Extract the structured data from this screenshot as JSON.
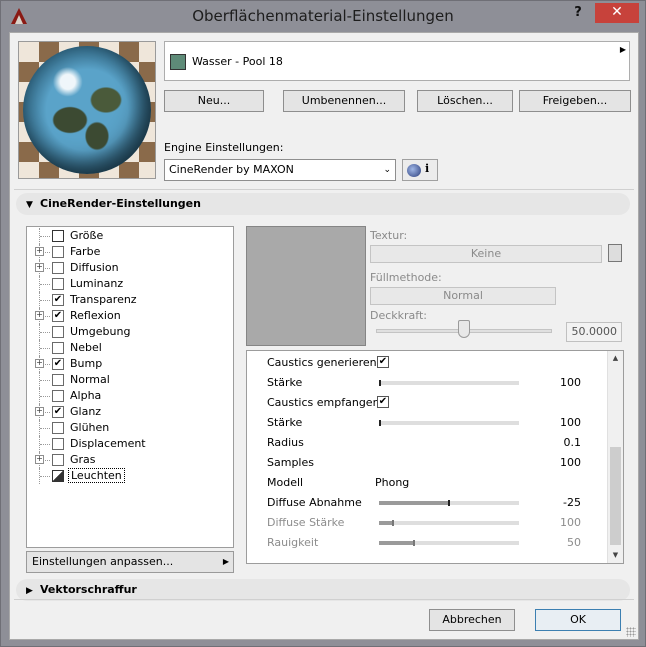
{
  "window": {
    "title": "Oberflächenmaterial-Einstellungen",
    "help_label": "?",
    "close_label": "✕"
  },
  "material": {
    "name": "Wasser - Pool 18",
    "swatch_color": "#5e8b78",
    "buttons": {
      "new": "Neu...",
      "rename": "Umbenennen...",
      "delete": "Löschen...",
      "share": "Freigeben..."
    }
  },
  "engine": {
    "label": "Engine Einstellungen:",
    "selected": "CineRender by MAXON",
    "info_label": "i"
  },
  "sections": {
    "cinerender": "CineRender-Einstellungen",
    "vektor": "Vektorschraffur"
  },
  "tree": {
    "items": [
      {
        "label": "Größe",
        "expandable": false,
        "checked": null
      },
      {
        "label": "Farbe",
        "expandable": true,
        "checked": false
      },
      {
        "label": "Diffusion",
        "expandable": true,
        "checked": false
      },
      {
        "label": "Luminanz",
        "expandable": false,
        "checked": false
      },
      {
        "label": "Transparenz",
        "expandable": false,
        "checked": true
      },
      {
        "label": "Reflexion",
        "expandable": true,
        "checked": true
      },
      {
        "label": "Umgebung",
        "expandable": false,
        "checked": false
      },
      {
        "label": "Nebel",
        "expandable": false,
        "checked": false
      },
      {
        "label": "Bump",
        "expandable": true,
        "checked": true
      },
      {
        "label": "Normal",
        "expandable": false,
        "checked": false
      },
      {
        "label": "Alpha",
        "expandable": false,
        "checked": false
      },
      {
        "label": "Glanz",
        "expandable": true,
        "checked": true
      },
      {
        "label": "Glühen",
        "expandable": false,
        "checked": false
      },
      {
        "label": "Displacement",
        "expandable": false,
        "checked": false
      },
      {
        "label": "Gras",
        "expandable": true,
        "checked": false
      },
      {
        "label": "Leuchten",
        "expandable": false,
        "checked": null
      }
    ],
    "customize_label": "Einstellungen anpassen..."
  },
  "texture": {
    "texture_label": "Textur:",
    "texture_value": "Keine",
    "fill_label": "Füllmethode:",
    "fill_value": "Normal",
    "opacity_label": "Deckkraft:",
    "opacity_value": "50.0000",
    "opacity_fraction": 0.5
  },
  "properties": [
    {
      "label": "Caustics generieren",
      "kind": "check",
      "checked": true
    },
    {
      "label": "Stärke",
      "kind": "bar",
      "value": "100"
    },
    {
      "label": "Caustics empfangen",
      "kind": "check",
      "checked": true
    },
    {
      "label": "Stärke",
      "kind": "bar",
      "value": "100"
    },
    {
      "label": "Radius",
      "kind": "value",
      "value": "0.1"
    },
    {
      "label": "Samples",
      "kind": "value",
      "value": "100"
    },
    {
      "label": "Modell",
      "kind": "text",
      "value": "Phong"
    },
    {
      "label": "Diffuse Abnahme",
      "kind": "bar",
      "value": "-25",
      "fill": 0.5
    },
    {
      "label": "Diffuse Stärke",
      "kind": "bar",
      "value": "100",
      "fill": 0.1,
      "disabled": true
    },
    {
      "label": "Rauigkeit",
      "kind": "bar",
      "value": "50",
      "fill": 0.25,
      "disabled": true
    }
  ],
  "footer": {
    "cancel": "Abbrechen",
    "ok": "OK"
  }
}
